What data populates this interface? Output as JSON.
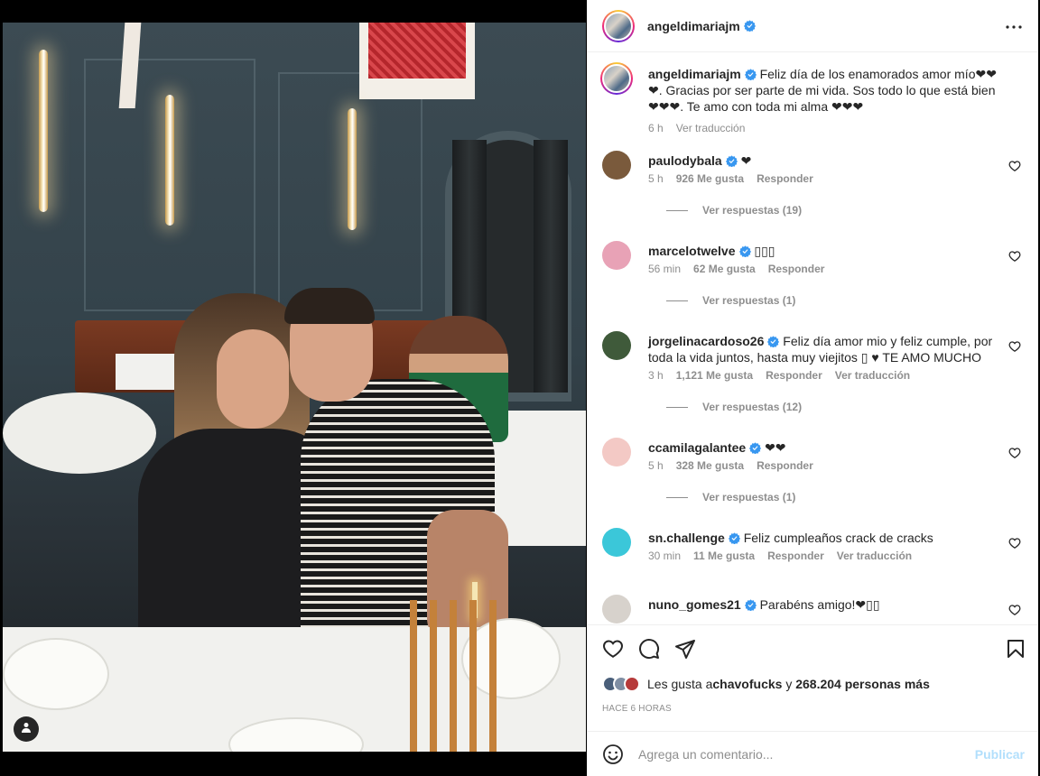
{
  "post": {
    "author": "angeldimariajm",
    "caption": "Feliz día de los enamorados amor mío❤❤❤. Gracias por ser parte de mi vida. Sos todo lo que está bien ❤❤❤. Te amo con toda mi alma ❤❤❤",
    "caption_time": "6 h",
    "caption_translate": "Ver traducción",
    "likes_prefix": "Les gusta a ",
    "likes_user": "chavofucks",
    "likes_mid": " y ",
    "likes_count": "268.204 personas más",
    "time_ago": "HACE 6 HORAS"
  },
  "comments": [
    {
      "user": "paulodybala",
      "text": "❤",
      "time": "5 h",
      "likes": "926 Me gusta",
      "reply": "Responder",
      "translate": "",
      "replies": "Ver respuestas (19)",
      "avatar_color": "#7a5a3c"
    },
    {
      "user": "marcelotwelve",
      "text": "▯▯▯",
      "time": "56 min",
      "likes": "62 Me gusta",
      "reply": "Responder",
      "translate": "",
      "replies": "Ver respuestas (1)",
      "avatar_color": "#e8a2b6"
    },
    {
      "user": "jorgelinacardoso26",
      "text": "Feliz día amor mio y feliz cumple, por toda la vida juntos, hasta muy viejitos ▯ ♥ TE AMO MUCHO",
      "time": "3 h",
      "likes": "1,121 Me gusta",
      "reply": "Responder",
      "translate": "Ver traducción",
      "replies": "Ver respuestas (12)",
      "avatar_color": "#3f5a3a"
    },
    {
      "user": "ccamilagalantee",
      "text": "❤❤",
      "time": "5 h",
      "likes": "328 Me gusta",
      "reply": "Responder",
      "translate": "",
      "replies": "Ver respuestas (1)",
      "avatar_color": "#f3c9c5"
    },
    {
      "user": "sn.challenge",
      "text": "Feliz cumpleaños crack de cracks",
      "time": "30 min",
      "likes": "11 Me gusta",
      "reply": "Responder",
      "translate": "Ver traducción",
      "replies": "",
      "avatar_color": "#3bc7d9"
    },
    {
      "user": "nuno_gomes21",
      "text": "Parabéns amigo!❤▯▯",
      "time": "",
      "likes": "",
      "reply": "",
      "translate": "",
      "replies": "",
      "avatar_color": "#d7d2cc"
    }
  ],
  "add_comment": {
    "placeholder": "Agrega un comentario...",
    "publish": "Publicar"
  },
  "icons": {
    "verified": "verified-badge-icon",
    "like": "heart-icon",
    "comment": "comment-icon",
    "share": "send-icon",
    "save": "bookmark-icon",
    "more": "more-options-icon",
    "emoji": "emoji-icon",
    "tag": "user-tag-icon"
  },
  "colors": {
    "verified": "#3897f0",
    "secondary_text": "#8e8e8e",
    "publish_disabled": "#b2dffc"
  }
}
